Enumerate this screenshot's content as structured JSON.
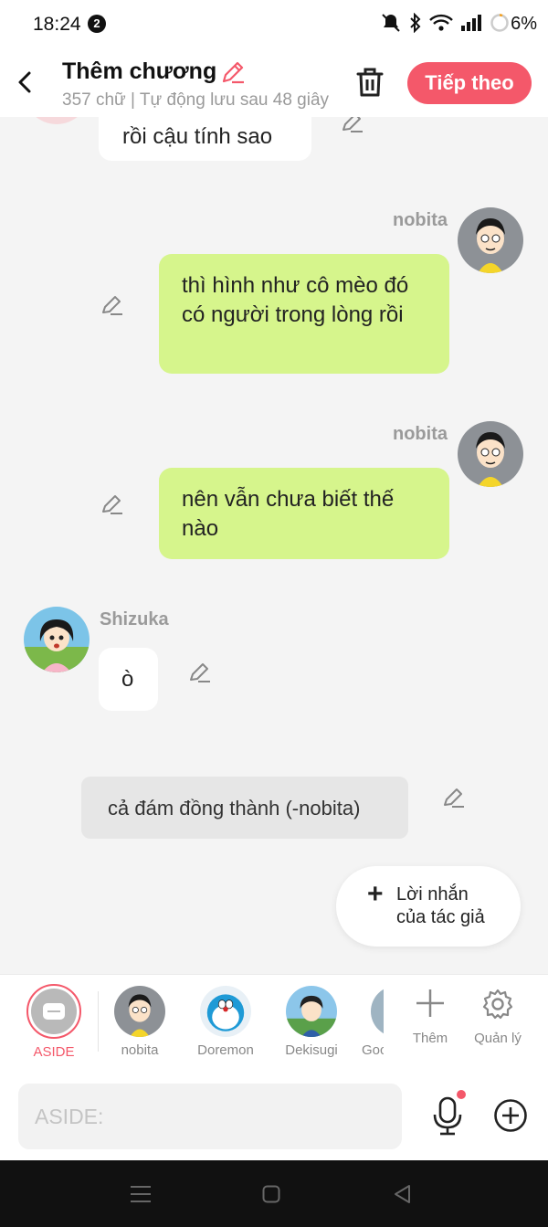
{
  "status_bar": {
    "time": "18:24",
    "notification_count": "2",
    "battery": "6%"
  },
  "header": {
    "title": "Thêm chương",
    "subtitle": "357 chữ | Tự động lưu sau 48 giây",
    "next_label": "Tiếp theo"
  },
  "messages": [
    {
      "sender": "",
      "text": "rồi cậu tính sao"
    },
    {
      "sender": "nobita",
      "text": "thì hình như cô mèo đó có người trong lòng rồi"
    },
    {
      "sender": "nobita",
      "text": "nên vẫn chưa biết thế nào"
    },
    {
      "sender": "Shizuka",
      "text": "ò"
    },
    {
      "sender": "",
      "text": "cả đám đồng thành (-nobita)"
    }
  ],
  "author_note": {
    "line1": "Lời nhắn",
    "line2": "của tác giả"
  },
  "characters": [
    {
      "label": "ASIDE"
    },
    {
      "label": "nobita"
    },
    {
      "label": "Doremon"
    },
    {
      "label": "Dekisugi"
    },
    {
      "label": "Goc"
    }
  ],
  "actions": {
    "add_label": "Thêm",
    "manage_label": "Quản lý"
  },
  "input": {
    "placeholder": "ASIDE:"
  },
  "colors": {
    "accent": "#f4586a",
    "green_bubble": "#d6f58c",
    "aside_bubble": "#e6e6e6"
  }
}
